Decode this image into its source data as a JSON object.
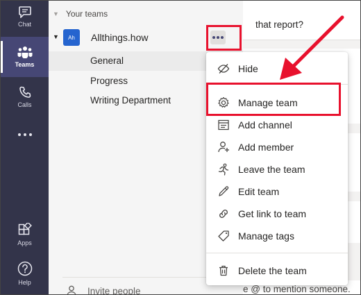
{
  "rail": {
    "items": [
      {
        "label": "Chat",
        "icon": "chat-icon"
      },
      {
        "label": "Teams",
        "icon": "teams-icon"
      },
      {
        "label": "Calls",
        "icon": "phone-icon"
      },
      {
        "label": "",
        "icon": "more-icon"
      },
      {
        "label": "Apps",
        "icon": "apps-icon"
      },
      {
        "label": "Help",
        "icon": "help-icon"
      }
    ]
  },
  "teams": {
    "section_title": "Your teams",
    "team": {
      "avatar_text": "Ah",
      "name": "Allthings.how",
      "channels": [
        "General",
        "Progress",
        "Writing Department"
      ]
    },
    "invite_label": "Invite people"
  },
  "chat": {
    "message_text": "that report?",
    "compose_hint": "e @ to mention someone."
  },
  "menu": {
    "items": [
      {
        "label": "Hide",
        "icon": "hide-icon"
      },
      {
        "label": "Manage team",
        "icon": "gear-icon"
      },
      {
        "label": "Add channel",
        "icon": "add-channel-icon"
      },
      {
        "label": "Add member",
        "icon": "add-member-icon"
      },
      {
        "label": "Leave the team",
        "icon": "leave-icon"
      },
      {
        "label": "Edit team",
        "icon": "pencil-icon"
      },
      {
        "label": "Get link to team",
        "icon": "link-icon"
      },
      {
        "label": "Manage tags",
        "icon": "tag-icon"
      },
      {
        "label": "Delete the team",
        "icon": "trash-icon"
      }
    ]
  },
  "colors": {
    "rail_bg": "#33344a",
    "brand": "#464775",
    "highlight": "#e8112d",
    "avatar": "#2564cf"
  }
}
